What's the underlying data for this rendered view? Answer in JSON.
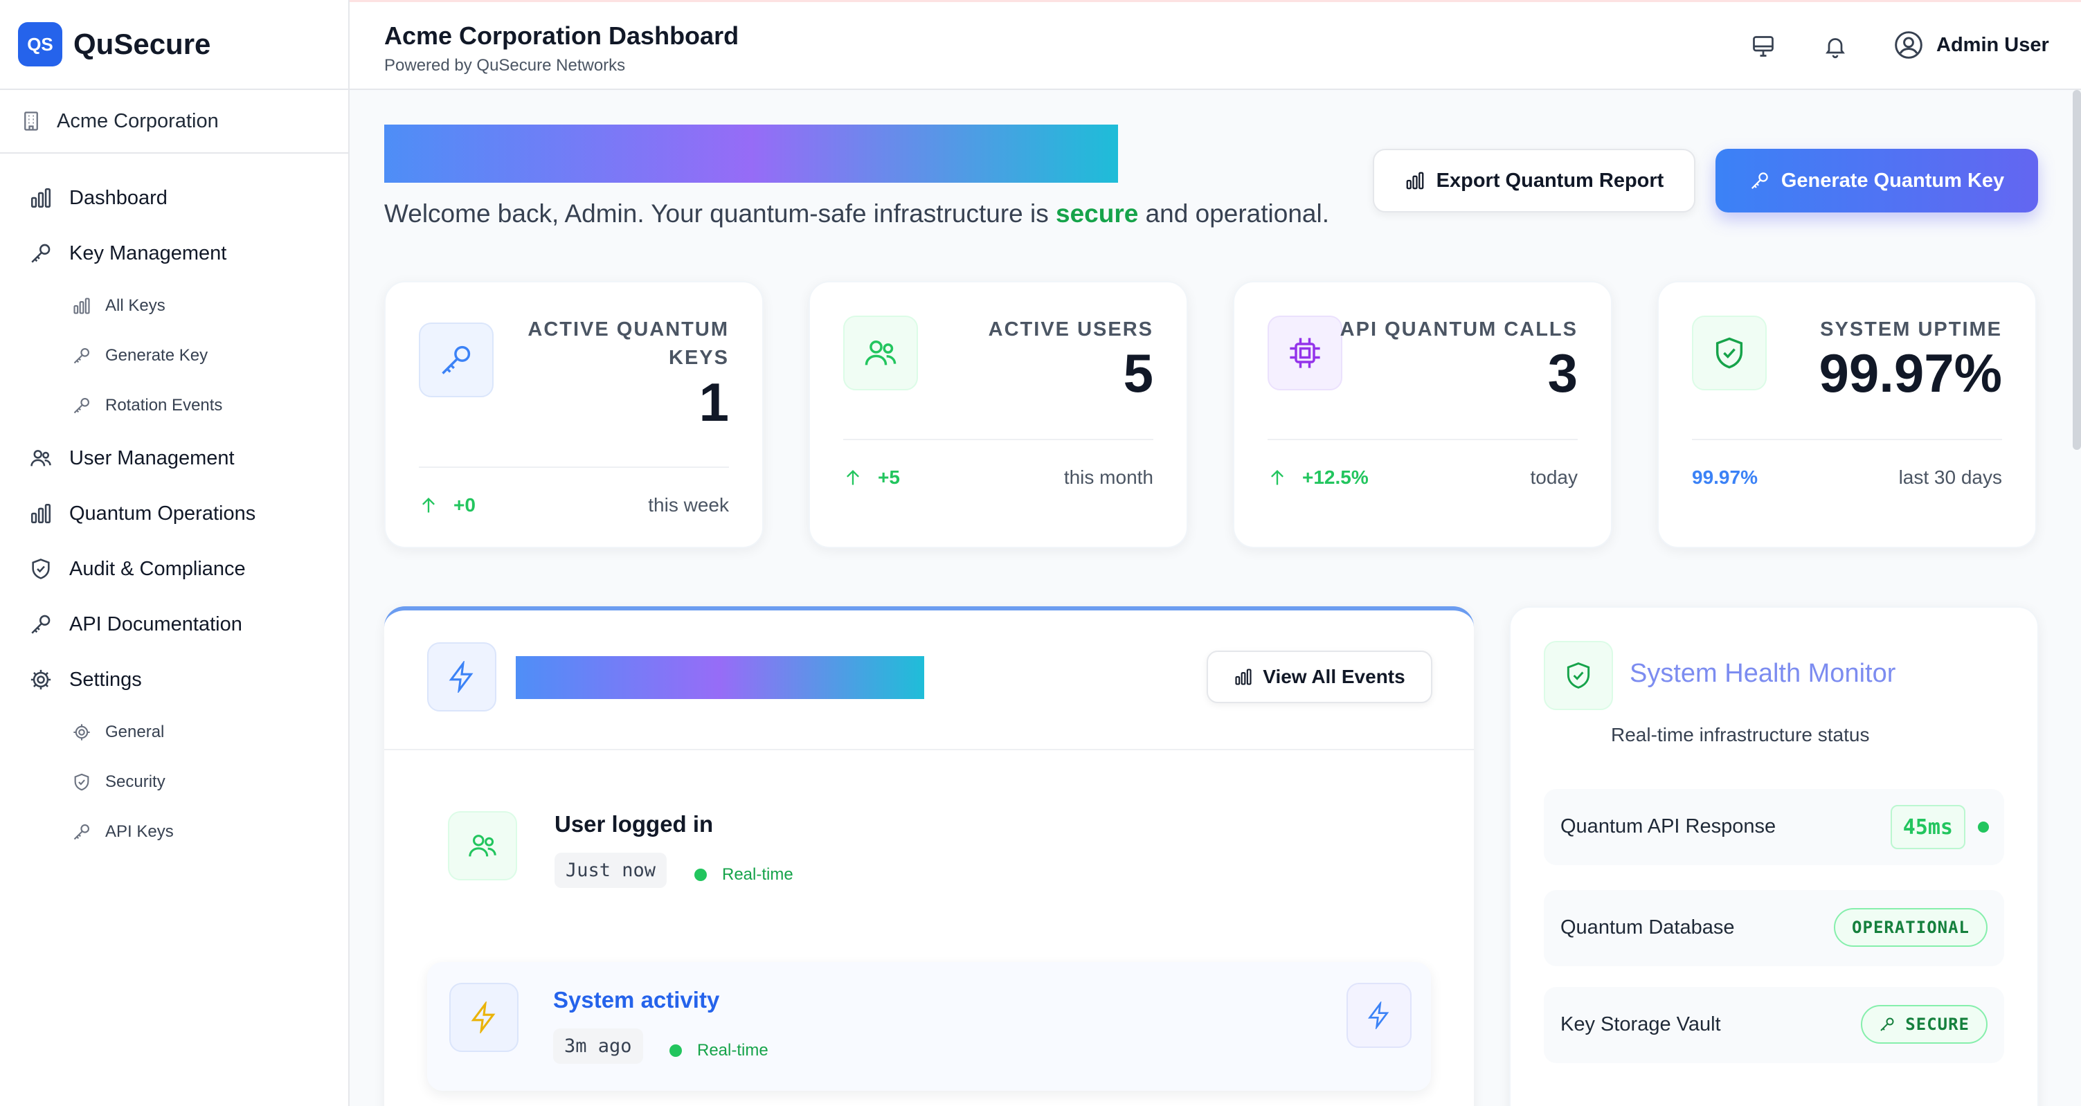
{
  "brand": {
    "logo_text": "QS",
    "name": "QuSecure",
    "accent": "#2563eb"
  },
  "organization": "Acme Corporation",
  "sidebar": {
    "items": [
      {
        "label": "Dashboard",
        "icon": "bar-chart-icon"
      },
      {
        "label": "Key Management",
        "icon": "key-icon",
        "children": [
          {
            "label": "All Keys",
            "icon": "bar-chart-icon"
          },
          {
            "label": "Generate Key",
            "icon": "key-icon"
          },
          {
            "label": "Rotation Events",
            "icon": "key-icon"
          }
        ]
      },
      {
        "label": "User Management",
        "icon": "users-icon"
      },
      {
        "label": "Quantum Operations",
        "icon": "bar-chart-icon"
      },
      {
        "label": "Audit & Compliance",
        "icon": "shield-icon"
      },
      {
        "label": "API Documentation",
        "icon": "key-icon"
      },
      {
        "label": "Settings",
        "icon": "gear-icon",
        "children": [
          {
            "label": "General",
            "icon": "gear-icon"
          },
          {
            "label": "Security",
            "icon": "shield-icon"
          },
          {
            "label": "API Keys",
            "icon": "key-icon"
          }
        ]
      }
    ]
  },
  "header": {
    "title": "Acme Corporation Dashboard",
    "subtitle": "Powered by QuSecure Networks",
    "user_name": "Admin User"
  },
  "welcome": {
    "before": "Welcome back, Admin. Your quantum-safe infrastructure is ",
    "highlight": "secure",
    "after": " and operational."
  },
  "actions": {
    "export_label": "Export Quantum Report",
    "generate_label": "Generate Quantum Key"
  },
  "stats": [
    {
      "label_lines": [
        "ACTIVE QUANTUM",
        "KEYS"
      ],
      "value": "1",
      "trend": "+0",
      "period": "this week",
      "icon": "key-icon",
      "color": "#3b82f6"
    },
    {
      "label_lines": [
        "ACTIVE USERS"
      ],
      "value": "5",
      "trend": "+5",
      "period": "this month",
      "icon": "users-icon",
      "color": "#22c55e"
    },
    {
      "label_lines": [
        "API QUANTUM CALLS"
      ],
      "value": "3",
      "trend": "+12.5%",
      "period": "today",
      "icon": "cpu-icon",
      "color": "#9333ea"
    },
    {
      "label_lines": [
        "SYSTEM UPTIME"
      ],
      "value": "99.97%",
      "trend": "99.97%",
      "period": "last 30 days",
      "icon": "shield-check-icon",
      "color": "#16a34a"
    }
  ],
  "events": {
    "view_all_label": "View All Events",
    "items": [
      {
        "title": "User logged in",
        "time": "Just now",
        "tag": "Real-time",
        "icon": "users-icon"
      },
      {
        "title": "System activity",
        "time": "3m ago",
        "tag": "Real-time",
        "icon": "lightning-icon"
      }
    ]
  },
  "health": {
    "title": "System Health Monitor",
    "subtitle": "Real-time infrastructure status",
    "rows": [
      {
        "label": "Quantum API Response",
        "value": "45ms"
      },
      {
        "label": "Quantum Database",
        "value": "OPERATIONAL"
      },
      {
        "label": "Key Storage Vault",
        "value": "SECURE"
      }
    ]
  }
}
